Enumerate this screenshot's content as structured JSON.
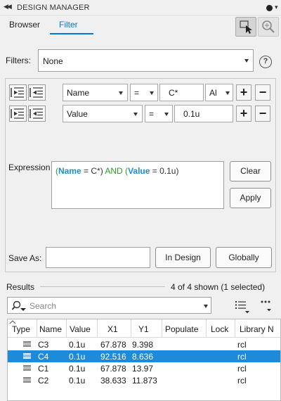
{
  "window": {
    "title": "DESIGN MANAGER"
  },
  "tabs": [
    {
      "label": "Browser"
    },
    {
      "label": "Filter",
      "active": true
    }
  ],
  "filters": {
    "label": "Filters:",
    "selected": "None"
  },
  "criteria": [
    {
      "field": "Name",
      "operator": "=",
      "value": "C*",
      "scope": "Al"
    },
    {
      "field": "Value",
      "operator": "=",
      "value": "0.1u"
    }
  ],
  "expression": {
    "label": "Expression",
    "tokens": [
      "(",
      "Name",
      " = C*) ",
      "AND",
      " (",
      "Value",
      " = 0.1u)"
    ]
  },
  "buttons": {
    "clear": "Clear",
    "apply": "Apply",
    "in_design": "In Design",
    "globally": "Globally"
  },
  "save_as": {
    "label": "Save As:",
    "value": ""
  },
  "results": {
    "label": "Results",
    "count": "4 of 4 shown (1 selected)",
    "search_placeholder": "Search",
    "columns": [
      "Type",
      "Name",
      "Value",
      "X1",
      "Y1",
      "Populate",
      "Lock",
      "Library N"
    ],
    "rows": [
      {
        "name": "C3",
        "value": "0.1u",
        "x1": "67.878",
        "y1": "9.398",
        "library": "rcl",
        "selected": false
      },
      {
        "name": "C4",
        "value": "0.1u",
        "x1": "92.516",
        "y1": "8.636",
        "library": "rcl",
        "selected": true
      },
      {
        "name": "C1",
        "value": "0.1u",
        "x1": "67.878",
        "y1": "13.97",
        "library": "rcl",
        "selected": false
      },
      {
        "name": "C2",
        "value": "0.1u",
        "x1": "38.633",
        "y1": "11.873",
        "library": "rcl",
        "selected": false
      }
    ]
  },
  "colors": {
    "accent": "#0078d7",
    "selection": "#1e8ad8",
    "expr_field": "#1a8fd6",
    "expr_keyword": "#2c9c2c"
  },
  "icons": [
    "collapse-icon",
    "pin-icon",
    "select-tool-icon",
    "zoom-tool-icon",
    "help-icon",
    "indent-left-icon",
    "indent-right-icon",
    "search-icon",
    "list-view-icon",
    "more-icon",
    "component-icon"
  ]
}
